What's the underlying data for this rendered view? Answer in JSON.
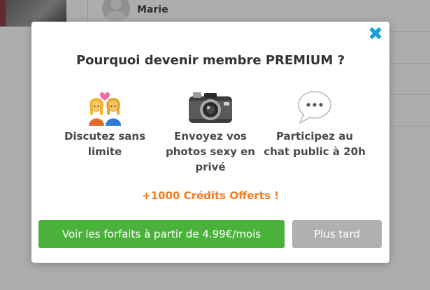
{
  "background": {
    "list": [
      {
        "name": "Marie"
      }
    ]
  },
  "modal": {
    "title": "Pourquoi devenir membre PREMIUM ?",
    "close_icon": "close-icon",
    "features": [
      {
        "icon": "couple-heart-icon",
        "label": "Discutez sans limite"
      },
      {
        "icon": "camera-icon",
        "label": "Envoyez vos photos sexy en privé"
      },
      {
        "icon": "speech-bubble-icon",
        "label": "Participez au chat public à 20h"
      }
    ],
    "credits": "+1000 Crédits Offerts !",
    "primary_button": "Voir les forfaits à partir de 4.99€/mois",
    "secondary_button": "Plus tard"
  },
  "colors": {
    "close": "#1a9fd9",
    "credits": "#f47c20",
    "primary_button": "#4ab23a",
    "secondary_button": "#b0b0b0"
  }
}
